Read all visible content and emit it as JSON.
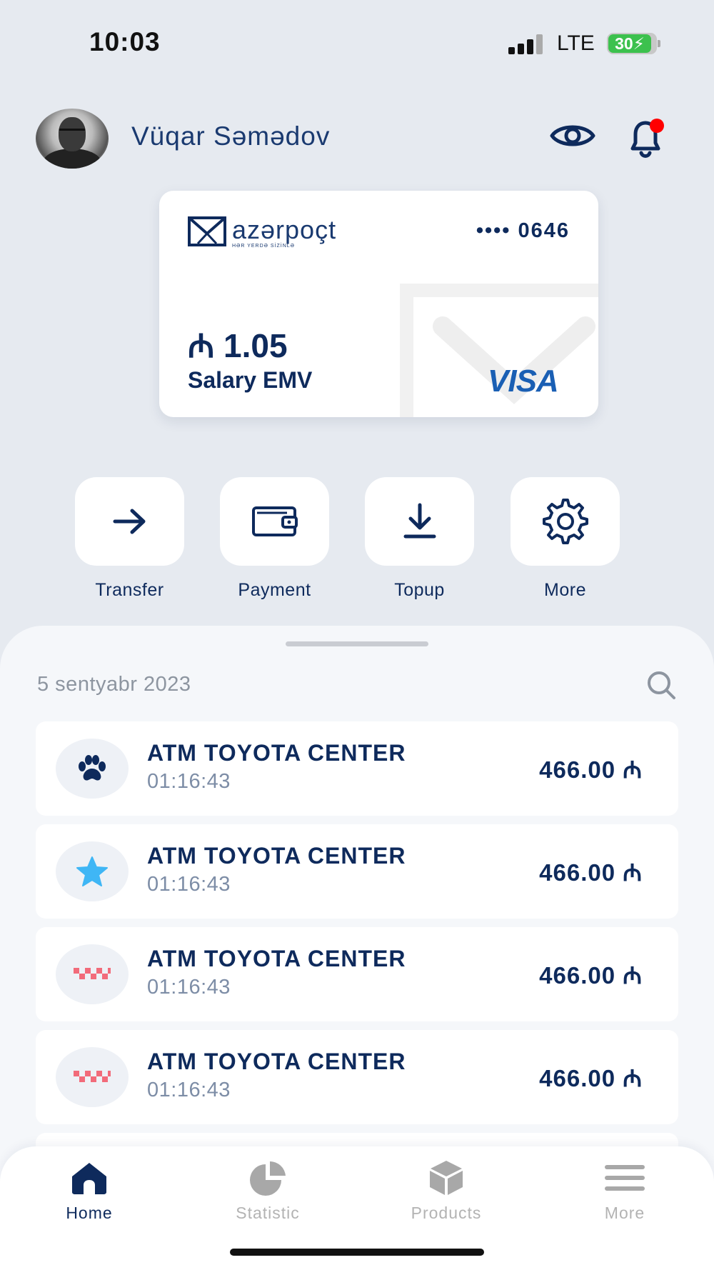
{
  "status_bar": {
    "time": "10:03",
    "network": "LTE",
    "battery": "30"
  },
  "header": {
    "user_name": "Vüqar Səmədov",
    "icons": [
      "eye-icon",
      "bell-icon"
    ],
    "notification_dot_color": "#ff0000"
  },
  "card": {
    "brand": "azərpoçt",
    "brand_tagline": "HƏR YERDƏ SİZİNLƏ",
    "number_masked": "•••• 0646",
    "balance": "₼ 1.05",
    "type": "Salary EMV",
    "network": "VISA"
  },
  "actions": [
    {
      "label": "Transfer",
      "icon": "arrow-right-icon"
    },
    {
      "label": "Payment",
      "icon": "wallet-icon"
    },
    {
      "label": "Topup",
      "icon": "download-icon"
    },
    {
      "label": "More",
      "icon": "gear-icon"
    }
  ],
  "transactions": {
    "date": "5 sentyabr 2023",
    "items": [
      {
        "title": "ATM TOYOTA CENTER",
        "time": "01:16:43",
        "amount": "466.00 ₼",
        "icon": "paw-icon"
      },
      {
        "title": "ATM TOYOTA CENTER",
        "time": "01:16:43",
        "amount": "466.00 ₼",
        "icon": "star-icon"
      },
      {
        "title": "ATM TOYOTA CENTER",
        "time": "01:16:43",
        "amount": "466.00 ₼",
        "icon": "taxi-checker-icon"
      },
      {
        "title": "ATM TOYOTA CENTER",
        "time": "01:16:43",
        "amount": "466.00 ₼",
        "icon": "taxi-checker-icon"
      }
    ]
  },
  "tabbar": {
    "tabs": [
      {
        "label": "Home",
        "icon": "home-icon",
        "active": true
      },
      {
        "label": "Statistic",
        "icon": "pie-chart-icon",
        "active": false
      },
      {
        "label": "Products",
        "icon": "box-icon",
        "active": false
      },
      {
        "label": "More",
        "icon": "menu-icon",
        "active": false
      }
    ]
  },
  "colors": {
    "primary": "#0e2a5c",
    "background": "#e6eaf0",
    "inactive": "#b3b3b3",
    "star": "#3fb6f5",
    "taxi": "#f26b7a"
  }
}
